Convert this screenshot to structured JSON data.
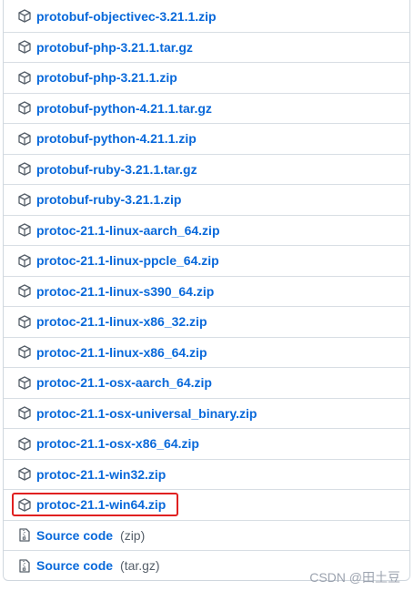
{
  "assets": [
    {
      "name": "protobuf-objectivec-3.21.1.zip",
      "icon": "package-icon"
    },
    {
      "name": "protobuf-php-3.21.1.tar.gz",
      "icon": "package-icon"
    },
    {
      "name": "protobuf-php-3.21.1.zip",
      "icon": "package-icon"
    },
    {
      "name": "protobuf-python-4.21.1.tar.gz",
      "icon": "package-icon"
    },
    {
      "name": "protobuf-python-4.21.1.zip",
      "icon": "package-icon"
    },
    {
      "name": "protobuf-ruby-3.21.1.tar.gz",
      "icon": "package-icon"
    },
    {
      "name": "protobuf-ruby-3.21.1.zip",
      "icon": "package-icon"
    },
    {
      "name": "protoc-21.1-linux-aarch_64.zip",
      "icon": "package-icon"
    },
    {
      "name": "protoc-21.1-linux-ppcle_64.zip",
      "icon": "package-icon"
    },
    {
      "name": "protoc-21.1-linux-s390_64.zip",
      "icon": "package-icon"
    },
    {
      "name": "protoc-21.1-linux-x86_32.zip",
      "icon": "package-icon"
    },
    {
      "name": "protoc-21.1-linux-x86_64.zip",
      "icon": "package-icon"
    },
    {
      "name": "protoc-21.1-osx-aarch_64.zip",
      "icon": "package-icon"
    },
    {
      "name": "protoc-21.1-osx-universal_binary.zip",
      "icon": "package-icon"
    },
    {
      "name": "protoc-21.1-osx-x86_64.zip",
      "icon": "package-icon"
    },
    {
      "name": "protoc-21.1-win32.zip",
      "icon": "package-icon"
    },
    {
      "name": "protoc-21.1-win64.zip",
      "icon": "package-icon",
      "highlighted": true
    }
  ],
  "source_code": [
    {
      "label": "Source code",
      "suffix": "(zip)",
      "icon": "file-zip-icon"
    },
    {
      "label": "Source code",
      "suffix": "(tar.gz)",
      "icon": "file-zip-icon"
    }
  ],
  "watermark": "CSDN @田土豆",
  "colors": {
    "link": "#0969da",
    "muted": "#57606a",
    "border": "#d0d7de",
    "highlight": "#e02020",
    "icon": "#57606a"
  }
}
